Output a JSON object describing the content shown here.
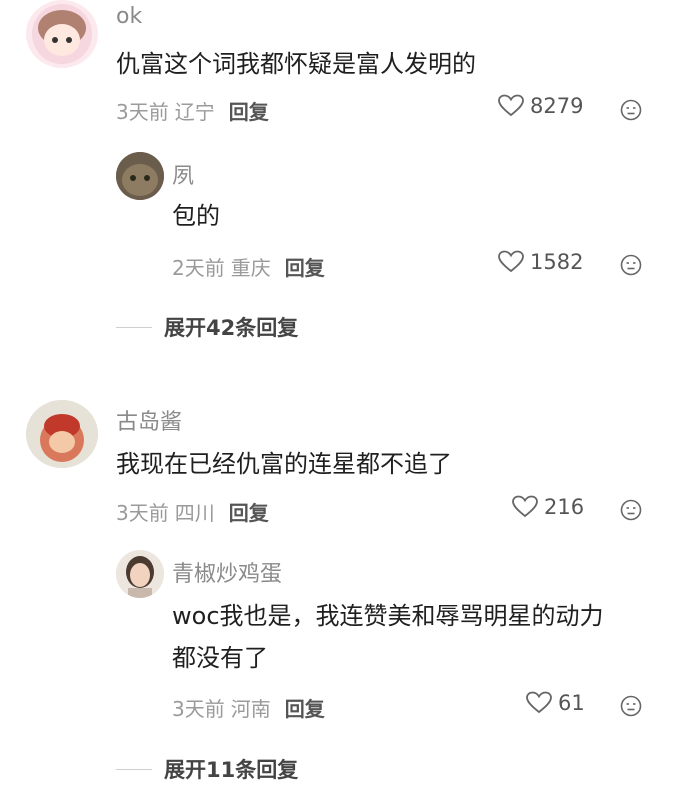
{
  "comments": [
    {
      "username": "ok",
      "text": "仇富这个词我都怀疑是富人发明的",
      "time": "3天前",
      "location": "辽宁",
      "reply_label": "回复",
      "likes": "8279",
      "replies": [
        {
          "username": "夙",
          "text": "包的",
          "time": "2天前",
          "location": "重庆",
          "reply_label": "回复",
          "likes": "1582"
        }
      ],
      "expand_label": "展开42条回复"
    },
    {
      "username": "古岛酱",
      "text": "我现在已经仇富的连星都不追了",
      "time": "3天前",
      "location": "四川",
      "reply_label": "回复",
      "likes": "216",
      "replies": [
        {
          "username": "青椒炒鸡蛋",
          "text_line1": "woc我也是，我连赞美和辱骂明星的动力",
          "text_line2": "都没有了",
          "time": "3天前",
          "location": "河南",
          "reply_label": "回复",
          "likes": "61"
        }
      ],
      "expand_label": "展开11条回复"
    }
  ],
  "colors": {
    "name": "#8a8a8a",
    "meta": "#9a9a9a",
    "text": "#1f1f1f",
    "divider": "#cfcfcf"
  }
}
